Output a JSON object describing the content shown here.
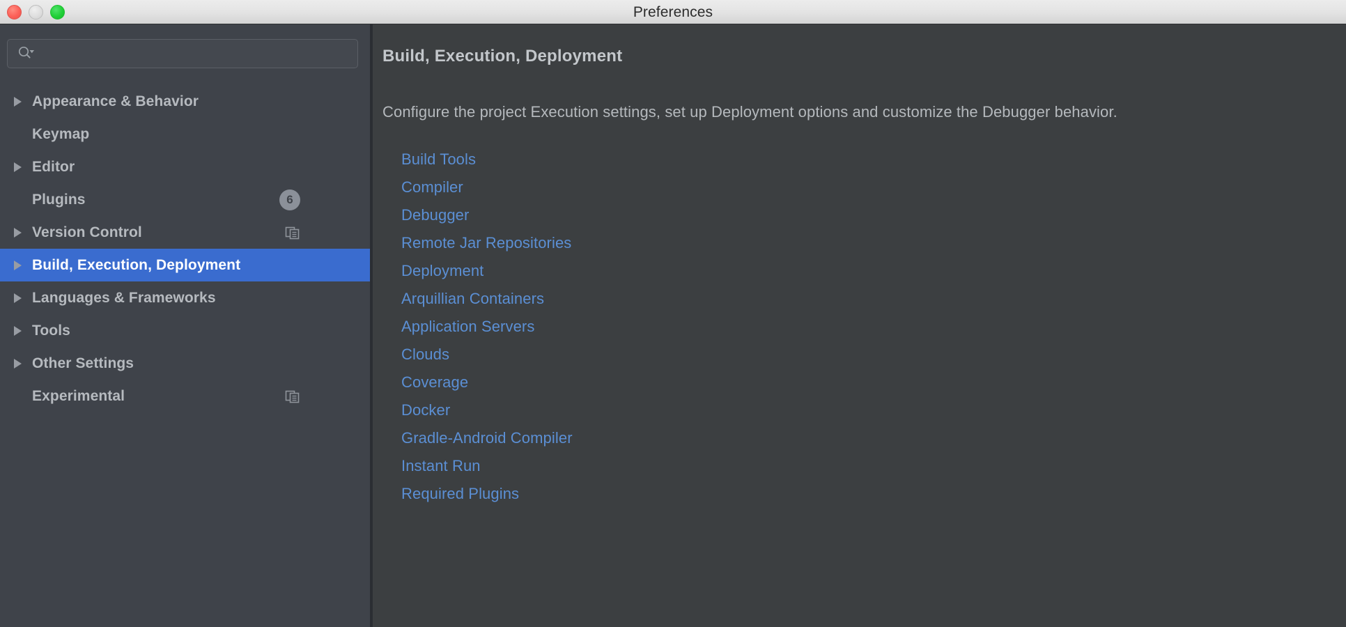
{
  "window": {
    "title": "Preferences",
    "traffic_lights": [
      {
        "name": "close-button",
        "color": "#fc6058"
      },
      {
        "name": "minimize-button",
        "color": "#dedede"
      },
      {
        "name": "maximize-button",
        "color": "#20cf37"
      }
    ]
  },
  "search": {
    "value": "",
    "placeholder": "",
    "icon": "search-icon"
  },
  "sidebar": {
    "items": [
      {
        "label": "Appearance & Behavior",
        "expandable": true,
        "selected": false,
        "badge": null,
        "icon": null
      },
      {
        "label": "Keymap",
        "expandable": false,
        "selected": false,
        "badge": null,
        "icon": null
      },
      {
        "label": "Editor",
        "expandable": true,
        "selected": false,
        "badge": null,
        "icon": null
      },
      {
        "label": "Plugins",
        "expandable": false,
        "selected": false,
        "badge": "6",
        "icon": null
      },
      {
        "label": "Version Control",
        "expandable": true,
        "selected": false,
        "badge": null,
        "icon": "copy-icon"
      },
      {
        "label": "Build, Execution, Deployment",
        "expandable": true,
        "selected": true,
        "badge": null,
        "icon": null
      },
      {
        "label": "Languages & Frameworks",
        "expandable": true,
        "selected": false,
        "badge": null,
        "icon": null
      },
      {
        "label": "Tools",
        "expandable": true,
        "selected": false,
        "badge": null,
        "icon": null
      },
      {
        "label": "Other Settings",
        "expandable": true,
        "selected": false,
        "badge": null,
        "icon": null
      },
      {
        "label": "Experimental",
        "expandable": false,
        "selected": false,
        "badge": null,
        "icon": "copy-icon"
      }
    ]
  },
  "detail": {
    "title": "Build, Execution, Deployment",
    "description": "Configure the project Execution settings, set up Deployment options and customize the Debugger behavior.",
    "links": [
      {
        "label": "Build Tools"
      },
      {
        "label": "Compiler"
      },
      {
        "label": "Debugger"
      },
      {
        "label": "Remote Jar Repositories"
      },
      {
        "label": "Deployment"
      },
      {
        "label": "Arquillian Containers"
      },
      {
        "label": "Application Servers"
      },
      {
        "label": "Clouds"
      },
      {
        "label": "Coverage"
      },
      {
        "label": "Docker"
      },
      {
        "label": "Gradle-Android Compiler"
      },
      {
        "label": "Instant Run"
      },
      {
        "label": "Required Plugins"
      }
    ]
  },
  "colors": {
    "sidebar_bg": "#3f434a",
    "detail_bg": "#3c3f41",
    "selection": "#3a6ccf",
    "link": "#5b8fd4",
    "text": "#b6babf",
    "titlebar": "#e4e4e4"
  }
}
